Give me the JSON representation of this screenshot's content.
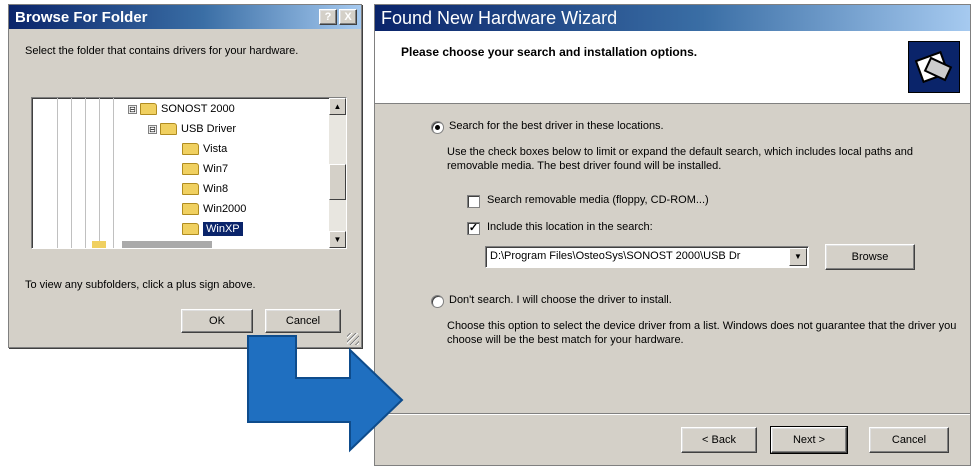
{
  "browse_dialog": {
    "title": "Browse For Folder",
    "help_label": "?",
    "close_label": "X",
    "instruction": "Select the folder that contains drivers for your hardware.",
    "tree": [
      {
        "label": "SONOST 2000",
        "expander": "⊟"
      },
      {
        "label": "USB Driver",
        "expander": "⊟"
      },
      {
        "label": "Vista"
      },
      {
        "label": "Win7"
      },
      {
        "label": "Win8"
      },
      {
        "label": "Win2000"
      },
      {
        "label": "WinXP",
        "selected": true
      }
    ],
    "hint": "To view any subfolders, click a plus sign above.",
    "ok_label": "OK",
    "cancel_label": "Cancel"
  },
  "wizard": {
    "title": "Found New Hardware Wizard",
    "header": "Please choose your search and installation options.",
    "option_search_label": "Search for the best driver in these locations.",
    "option_search_desc": "Use the check boxes below to limit or expand the default search, which includes local paths and removable media. The best driver found will be installed.",
    "check_removable_label": "Search removable media (floppy, CD-ROM...)",
    "check_removable_checked": false,
    "check_location_label": "Include this location in the search:",
    "check_location_checked": true,
    "path_value": "D:\\Program Files\\OsteoSys\\SONOST 2000\\USB Dr",
    "browse_label": "Browse",
    "option_dont_label": "Don't search. I will choose the driver to install.",
    "option_dont_desc": "Choose this option to select the device driver from a list.  Windows does not guarantee that the driver you choose will be the best match for your hardware.",
    "back_label": "< Back",
    "next_label": "Next >",
    "cancel_label": "Cancel"
  },
  "colors": {
    "arrow": "#1f6fc0",
    "title_start": "#0a246a",
    "title_end": "#a6caf0",
    "selection": "#0a246a"
  }
}
